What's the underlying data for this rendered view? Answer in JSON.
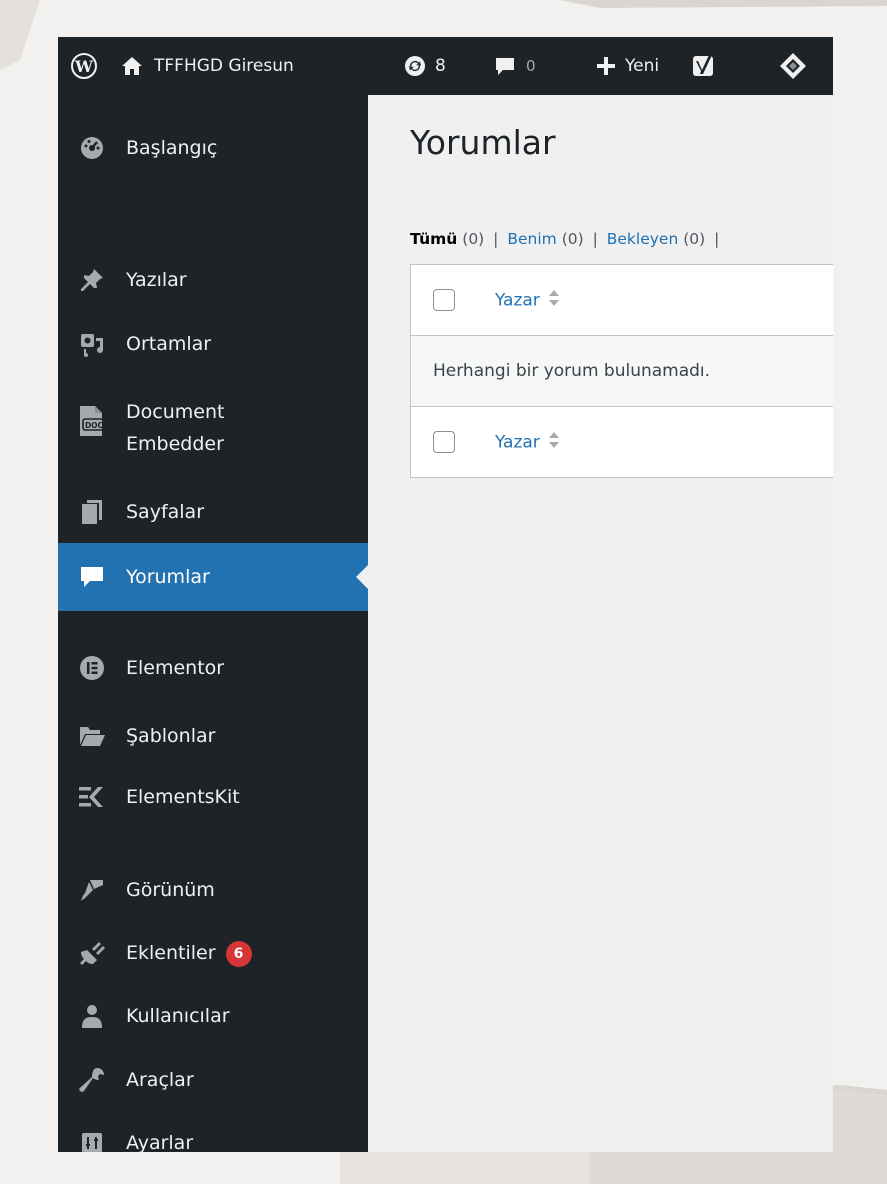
{
  "adminbar": {
    "site_name": "TFFHGD Giresun",
    "updates_count": "8",
    "comments_count": "0",
    "new_label": "Yeni"
  },
  "sidebar": {
    "items": [
      {
        "label": "Başlangıç",
        "icon": "dashboard-icon"
      },
      {
        "label": "Yazılar",
        "icon": "pin-icon"
      },
      {
        "label": "Ortamlar",
        "icon": "media-icon"
      },
      {
        "label": "Document",
        "label2": "Embedder",
        "icon": "doc-icon"
      },
      {
        "label": "Sayfalar",
        "icon": "pages-icon"
      },
      {
        "label": "Yorumlar",
        "icon": "comment-icon",
        "current": true
      },
      {
        "label": "Elementor",
        "icon": "elementor-icon"
      },
      {
        "label": "Şablonlar",
        "icon": "folder-icon"
      },
      {
        "label": "ElementsKit",
        "icon": "elementskit-icon"
      },
      {
        "label": "Görünüm",
        "icon": "brush-icon"
      },
      {
        "label": "Eklentiler",
        "icon": "plugin-icon",
        "badge": "6"
      },
      {
        "label": "Kullanıcılar",
        "icon": "users-icon"
      },
      {
        "label": "Araçlar",
        "icon": "wrench-icon"
      },
      {
        "label": "Ayarlar",
        "icon": "settings-icon"
      }
    ]
  },
  "main": {
    "title": "Yorumlar",
    "filters": {
      "all_label": "Tümü",
      "all_count": "(0)",
      "mine_label": "Benim",
      "mine_count": "(0)",
      "pending_label": "Bekleyen",
      "pending_count": "(0)",
      "sep": "|"
    },
    "table": {
      "author_header": "Yazar",
      "empty_message": "Herhangi bir yorum bulunamadı."
    }
  },
  "colors": {
    "adminbar_bg": "#1d2327",
    "accent": "#2271b1",
    "badge": "#d63638"
  }
}
